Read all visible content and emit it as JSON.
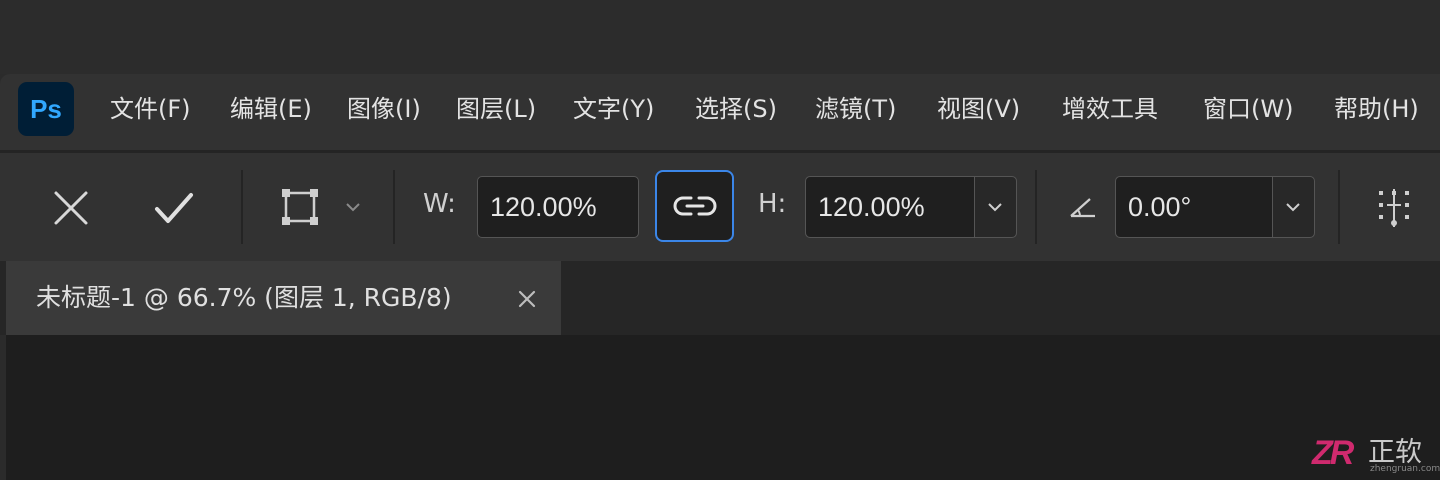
{
  "app": {
    "logo_text": "Ps",
    "brand_color": "#31a8ff",
    "logo_bg": "#001e36"
  },
  "menu": [
    {
      "label": "文件(F)"
    },
    {
      "label": "编辑(E)"
    },
    {
      "label": "图像(I)"
    },
    {
      "label": "图层(L)"
    },
    {
      "label": "文字(Y)"
    },
    {
      "label": "选择(S)"
    },
    {
      "label": "滤镜(T)"
    },
    {
      "label": "视图(V)"
    },
    {
      "label": "增效工具"
    },
    {
      "label": "窗口(W)"
    },
    {
      "label": "帮助(H)"
    }
  ],
  "options": {
    "cancel_icon": "x-icon",
    "commit_icon": "check-icon",
    "reference_icon": "transform-bounds-icon",
    "width_label": "W:",
    "width_value": "120.00%",
    "link_icon": "link-icon",
    "link_active_color": "#3b86e8",
    "height_label": "H:",
    "height_value": "120.00%",
    "angle_icon": "angle-icon",
    "angle_value": "0.00°",
    "interpolation_icon": "warp-grid-icon"
  },
  "document_tab": {
    "title": "未标题-1 @ 66.7% (图层 1, RGB/8)",
    "close_icon": "close-icon"
  },
  "watermark": {
    "logo": "ZR",
    "text": "正软",
    "subtext": "zhengruan.com",
    "color": "#cf2a6e"
  }
}
